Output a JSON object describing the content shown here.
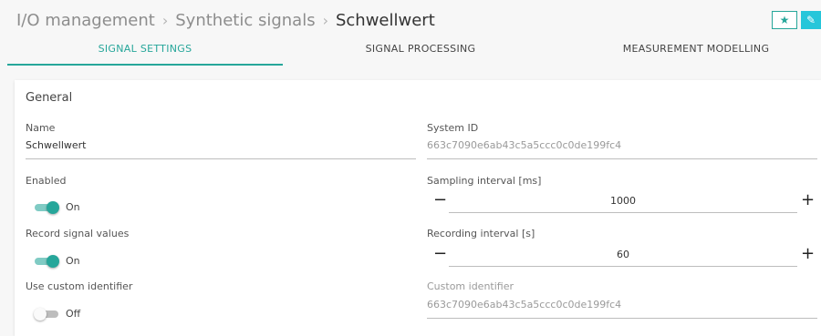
{
  "breadcrumb": {
    "items": [
      "I/O management",
      "Synthetic signals"
    ],
    "current": "Schwellwert",
    "separator": "›"
  },
  "actions": {
    "favorite_icon": "star-icon",
    "edit_icon": "pencil-icon"
  },
  "tabs": [
    {
      "label": "SIGNAL SETTINGS",
      "active": true
    },
    {
      "label": "SIGNAL PROCESSING",
      "active": false
    },
    {
      "label": "MEASUREMENT MODELLING",
      "active": false
    }
  ],
  "section": {
    "title": "General"
  },
  "fields": {
    "name": {
      "label": "Name",
      "value": "Schwellwert"
    },
    "system_id": {
      "label": "System ID",
      "value": "663c7090e6ab43c5a5ccc0c0de199fc4"
    },
    "enabled": {
      "label": "Enabled",
      "state": true,
      "state_label": "On"
    },
    "sampling_interval": {
      "label": "Sampling interval [ms]",
      "value": "1000",
      "minus": "−",
      "plus": "+"
    },
    "record_signal_values": {
      "label": "Record signal values",
      "state": true,
      "state_label": "On"
    },
    "recording_interval": {
      "label": "Recording interval [s]",
      "value": "60",
      "minus": "−",
      "plus": "+"
    },
    "use_custom_identifier": {
      "label": "Use custom identifier",
      "state": false,
      "state_label": "Off"
    },
    "custom_identifier": {
      "label": "Custom identifier",
      "value": "663c7090e6ab43c5a5ccc0c0de199fc4"
    }
  },
  "colors": {
    "accent": "#26a69a",
    "edit_button": "#26c6da"
  }
}
